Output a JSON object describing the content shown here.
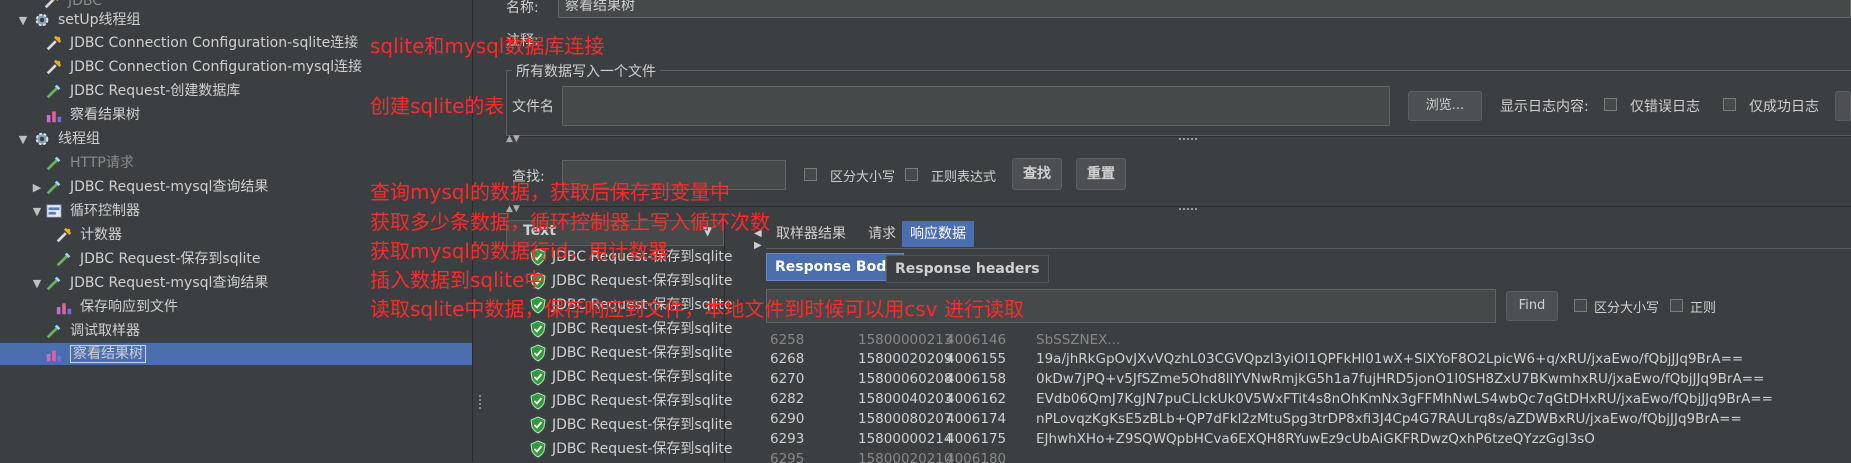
{
  "tree": {
    "items": [
      {
        "label": "JDBC",
        "icon": "config-icon"
      },
      {
        "label": "setUp线程组",
        "icon": "gear-icon"
      },
      {
        "label": "JDBC Connection Configuration-sqlite连接",
        "icon": "wrench-icon"
      },
      {
        "label": "JDBC Connection Configuration-mysql连接",
        "icon": "wrench-icon"
      },
      {
        "label": "JDBC Request-创建数据库",
        "icon": "pipette-icon"
      },
      {
        "label": "察看结果树",
        "icon": "chart-icon"
      },
      {
        "label": "线程组",
        "icon": "gear-icon"
      },
      {
        "label": "HTTP请求",
        "icon": "pipette-icon"
      },
      {
        "label": "JDBC Request-mysql查询结果",
        "icon": "pipette-icon"
      },
      {
        "label": "循环控制器",
        "icon": "loop-icon"
      },
      {
        "label": "计数器",
        "icon": "wrench-icon"
      },
      {
        "label": "JDBC Request-保存到sqlite",
        "icon": "pipette-icon"
      },
      {
        "label": "JDBC Request-mysql查询结果",
        "icon": "pipette-icon"
      },
      {
        "label": "保存响应到文件",
        "icon": "chart-icon"
      },
      {
        "label": "调试取样器",
        "icon": "pipette-icon"
      },
      {
        "label": "察看结果树",
        "icon": "chart-icon"
      }
    ]
  },
  "form": {
    "name_label": "名称:",
    "name_value": "察看结果树",
    "comment_label": "注释:",
    "section_title": "所有数据写入一个文件",
    "filename_label": "文件名",
    "browse_button": "浏览...",
    "log_label": "显示日志内容:",
    "errors_only": "仅错误日志",
    "success_only": "仅成功日志"
  },
  "search": {
    "label": "查找:",
    "case_sensitive": "区分大小写",
    "regex": "正则表达式",
    "find_button": "查找",
    "reset_button": "重置"
  },
  "results": {
    "renderer": "Text",
    "tabs": [
      "取样器结果",
      "请求",
      "响应数据"
    ],
    "subtabs": [
      "Response Body",
      "Response headers"
    ],
    "find_button": "Find",
    "case_sensitive": "区分大小写",
    "regex_partial": "正则",
    "samples": [
      "JDBC Request-保存到sqlite",
      "JDBC Request-保存到sqlite",
      "JDBC Request-保存到sqlite",
      "JDBC Request-保存到sqlite",
      "JDBC Request-保存到sqlite",
      "JDBC Request-保存到sqlite",
      "JDBC Request-保存到sqlite",
      "JDBC Request-保存到sqlite",
      "JDBC Request-保存到sqlite"
    ],
    "rows": [
      {
        "id": "6268",
        "phone": "15800020209",
        "code": "4006155",
        "token": "19a/jhRkGpOvJXvVQzhL03CGVQpzl3yiOl1QPFkHl01wX+SlXYoF8O2LpicW6+q/xRU/jxaEwo/fQbjJJq9BrA=="
      },
      {
        "id": "6270",
        "phone": "15800060208",
        "code": "4006158",
        "token": "0kDw7jPQ+v5JfSZme5Ohd8llYVNwRmjkG5h1a7fujHRD5jonO1l0SH8ZxU7BKwmhxRU/jxaEwo/fQbjJJq9BrA=="
      },
      {
        "id": "6282",
        "phone": "15800040203",
        "code": "4006162",
        "token": "EVdb06QmJ7KgJN7puCLlckUk0V5WxFTit4s8nOhKmNx3gFFMhNwLS4wbQc7qGtDHxRU/jxaEwo/fQbjJJq9BrA=="
      },
      {
        "id": "6290",
        "phone": "15800080207",
        "code": "4006174",
        "token": "nPLovqzKgKsE5zBLb+QP7dFkl2zMtuSpg3trDP8xfi3J4Cp4G7RAULrq8s/aZDWBxRU/jxaEwo/fQbjJJq9BrA=="
      },
      {
        "id": "6293",
        "phone": "15800000214",
        "code": "4006175",
        "token": "EJhwhXHo+Z9SQWQpbHCva6EXQH8RYuwEz9cUbAiGKFRDwzQxhP6tzeQYzzGgl3sO"
      }
    ]
  },
  "annotations": [
    "sqlite和mysql数据库连接",
    "创建sqlite的表",
    "查询mysql的数据，获取后保存到变量中",
    "获取多少条数据，循环控制器上写入循环次数",
    "获取mysql的数据行id，用计数器",
    "插入数据到sqlite中",
    "读取sqlite中数据，保存响应到文件，本地文件到时候可以用csv 进行读取"
  ],
  "colors": {
    "background": "#3c3f41",
    "selection": "#4b6eaf",
    "annotation": "#ff2a2a",
    "success": "#2e9b3a"
  }
}
